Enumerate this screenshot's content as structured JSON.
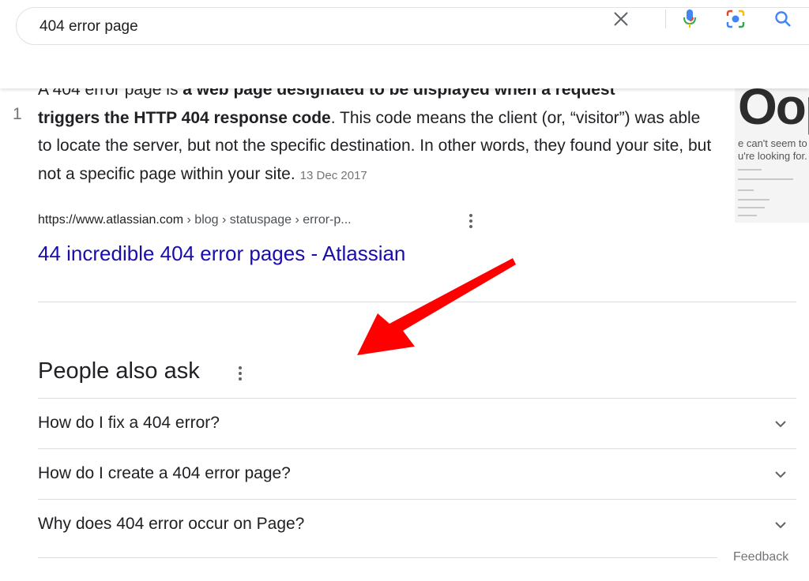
{
  "search": {
    "query": "404 error page",
    "clear_icon": "close-icon",
    "mic_icon": "microphone-icon",
    "lens_icon": "camera-lens-icon",
    "search_icon": "search-icon"
  },
  "featured_snippet": {
    "rank": "1",
    "text_partial_top": "A 404 error page is ",
    "bold_partial_top": "a web page designated to be displayed when a request",
    "bold_text": "triggers the HTTP 404 response code",
    "text_rest": ". This code means the client (or, “visitor”) was able to locate the server, but not the specific destination. In other words, they found your site, but not a specific page within your site.",
    "date": "13 Dec 2017",
    "thumbnail": {
      "big_text": "Oop",
      "line1": "e can't seem to",
      "line2": "u're looking for."
    },
    "source_url": "https://www.atlassian.com",
    "source_crumbs": " › blog › statuspage › error-p...",
    "title": "44 incredible 404 error pages - Atlassian"
  },
  "people_also_ask": {
    "heading": "People also ask",
    "questions": [
      "How do I fix a 404 error?",
      "How do I create a 404 error page?",
      "Why does 404 error occur on Page?"
    ]
  },
  "feedback": "Feedback",
  "colors": {
    "link": "#1a0dab",
    "arrow": "#ff0000",
    "muted": "#70757a"
  }
}
